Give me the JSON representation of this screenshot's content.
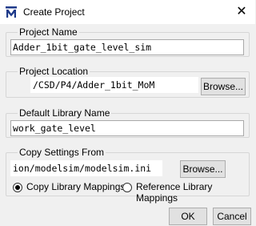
{
  "window": {
    "title": "Create Project",
    "close_glyph": "✕",
    "accent": "#1e3a8a"
  },
  "project_name": {
    "label": "Project Name",
    "value": "Adder_1bit_gate_level_sim"
  },
  "project_location": {
    "label": "Project Location",
    "value": "/CSD/P4/Adder_1bit_MoM",
    "browse_label": "Browse..."
  },
  "default_library": {
    "label": "Default Library Name",
    "value": "work_gate_level"
  },
  "copy_settings": {
    "label": "Copy Settings From",
    "value": "ion/modelsim/modelsim.ini",
    "browse_label": "Browse...",
    "option_copy": "Copy Library Mappings",
    "option_reference": "Reference Library Mappings",
    "selected": "copy"
  },
  "footer": {
    "ok_label": "OK",
    "cancel_label": "Cancel"
  }
}
